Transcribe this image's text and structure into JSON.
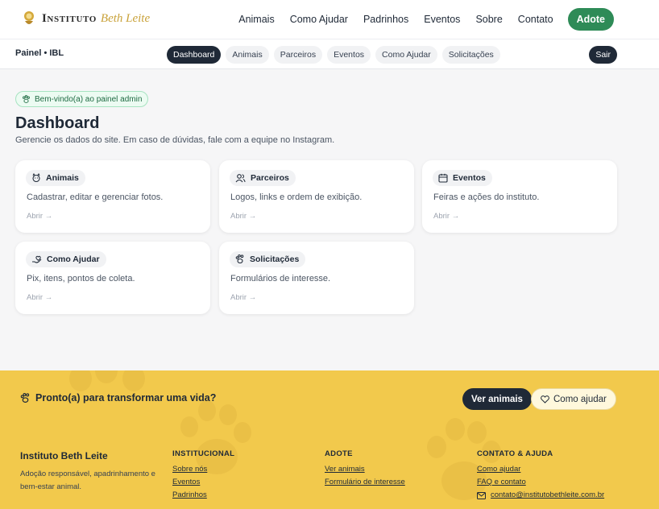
{
  "brand": {
    "name": "Instituto",
    "script": "Beth Leite"
  },
  "nav": {
    "items": [
      "Animais",
      "Como Ajudar",
      "Padrinhos",
      "Eventos",
      "Sobre",
      "Contato"
    ],
    "cta": "Adote"
  },
  "admin": {
    "panel_title": "Painel • IBL",
    "tabs": [
      "Dashboard",
      "Animais",
      "Parceiros",
      "Eventos",
      "Como Ajudar",
      "Solicitações"
    ],
    "active_tab": "Dashboard",
    "logout": "Sair"
  },
  "header": {
    "welcome": "Bem-vindo(a) ao painel admin",
    "title": "Dashboard",
    "description": "Gerencie os dados do site. Em caso de dúvidas, fale com a equipe no Instagram."
  },
  "cards": [
    {
      "title": "Animais",
      "description": "Cadastrar, editar e gerenciar fotos.",
      "link": "Abrir →",
      "icon": "dog-icon"
    },
    {
      "title": "Parceiros",
      "description": "Logos, links e ordem de exibição.",
      "link": "Abrir →",
      "icon": "users-icon"
    },
    {
      "title": "Eventos",
      "description": "Feiras e ações do instituto.",
      "link": "Abrir →",
      "icon": "calendar-icon"
    },
    {
      "title": "Como Ajudar",
      "description": "Pix, itens, pontos de coleta.",
      "link": "Abrir →",
      "icon": "hand-heart-icon"
    },
    {
      "title": "Solicitações",
      "description": "Formulários de interesse.",
      "link": "Abrir →",
      "icon": "paw-icon"
    }
  ],
  "footer": {
    "cta_text": "Pronto(a) para transformar uma vida?",
    "btn_primary": "Ver animais",
    "btn_secondary": "Como ajudar",
    "brand": "Instituto Beth Leite",
    "about": "Adoção responsável, apadrinhamento e bem-estar animal.",
    "columns": [
      {
        "heading": "INSTITUCIONAL",
        "links": [
          "Sobre nós",
          "Eventos",
          "Padrinhos"
        ]
      },
      {
        "heading": "ADOTE",
        "links": [
          "Ver animais",
          "Formulário de interesse"
        ]
      },
      {
        "heading": "CONTATO & AJUDA",
        "links": [
          "Como ajudar",
          "FAQ e contato"
        ],
        "email": "contato@institutobethleite.com.br"
      }
    ]
  },
  "colors": {
    "accent_green": "#2e8b57",
    "dark": "#1f2937",
    "footer_yellow": "#f2c94c"
  }
}
